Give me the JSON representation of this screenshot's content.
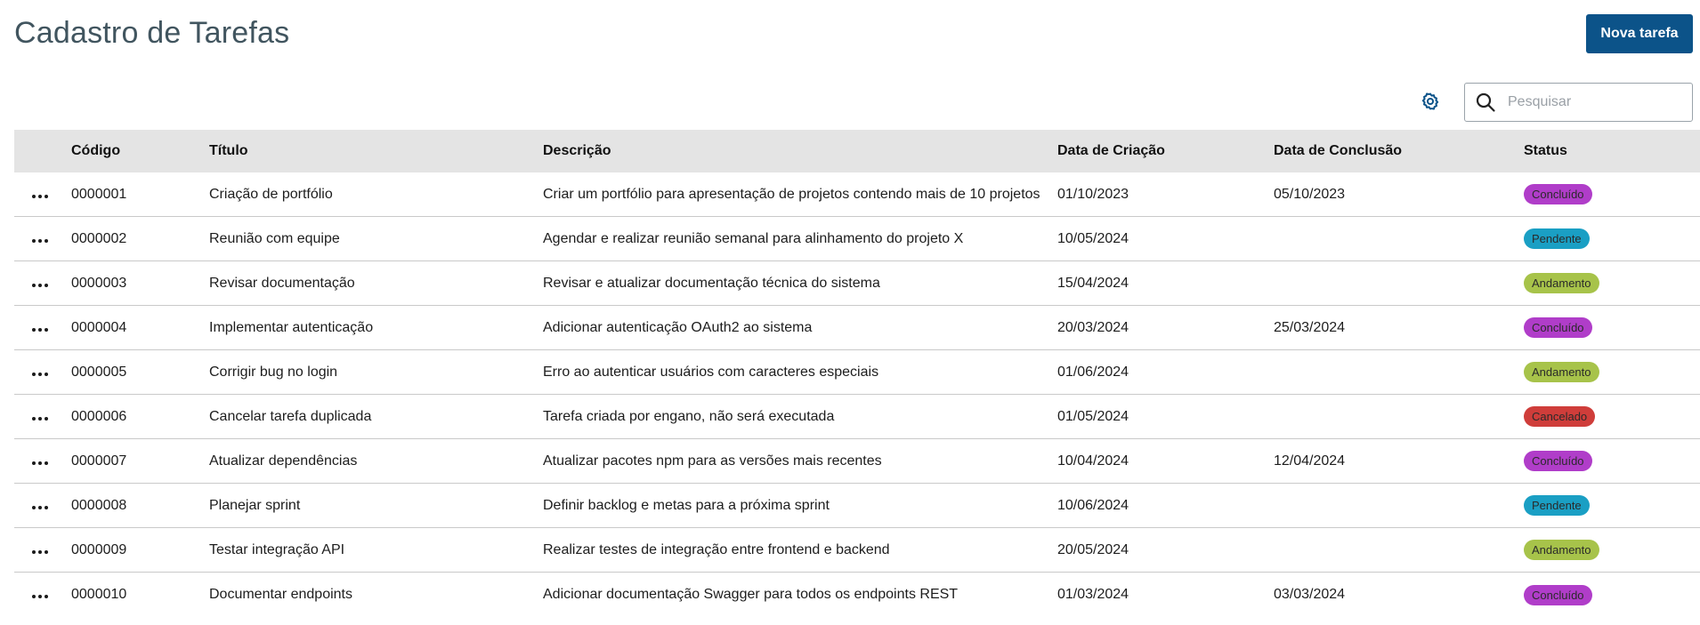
{
  "header": {
    "title": "Cadastro de Tarefas",
    "new_button_label": "Nova tarefa"
  },
  "toolbar": {
    "settings_icon": "gear-icon",
    "search_icon": "search-icon",
    "search_placeholder": "Pesquisar",
    "search_value": ""
  },
  "table": {
    "columns": [
      "",
      "Código",
      "Título",
      "Descrição",
      "Data de Criação",
      "Data de Conclusão",
      "Status"
    ],
    "rows": [
      {
        "code": "0000001",
        "title": "Criação de portfólio",
        "description": "Criar um portfólio para apresentação de projetos contendo mais de 10 projetos",
        "created": "01/10/2023",
        "completed": "05/10/2023",
        "status": "Concluído"
      },
      {
        "code": "0000002",
        "title": "Reunião com equipe",
        "description": "Agendar e realizar reunião semanal para alinhamento do projeto X",
        "created": "10/05/2024",
        "completed": "",
        "status": "Pendente"
      },
      {
        "code": "0000003",
        "title": "Revisar documentação",
        "description": "Revisar e atualizar documentação técnica do sistema",
        "created": "15/04/2024",
        "completed": "",
        "status": "Andamento"
      },
      {
        "code": "0000004",
        "title": "Implementar autenticação",
        "description": "Adicionar autenticação OAuth2 ao sistema",
        "created": "20/03/2024",
        "completed": "25/03/2024",
        "status": "Concluído"
      },
      {
        "code": "0000005",
        "title": "Corrigir bug no login",
        "description": "Erro ao autenticar usuários com caracteres especiais",
        "created": "01/06/2024",
        "completed": "",
        "status": "Andamento"
      },
      {
        "code": "0000006",
        "title": "Cancelar tarefa duplicada",
        "description": "Tarefa criada por engano, não será executada",
        "created": "01/05/2024",
        "completed": "",
        "status": "Cancelado"
      },
      {
        "code": "0000007",
        "title": "Atualizar dependências",
        "description": "Atualizar pacotes npm para as versões mais recentes",
        "created": "10/04/2024",
        "completed": "12/04/2024",
        "status": "Concluído"
      },
      {
        "code": "0000008",
        "title": "Planejar sprint",
        "description": "Definir backlog e metas para a próxima sprint",
        "created": "10/06/2024",
        "completed": "",
        "status": "Pendente"
      },
      {
        "code": "0000009",
        "title": "Testar integração API",
        "description": "Realizar testes de integração entre frontend e backend",
        "created": "20/05/2024",
        "completed": "",
        "status": "Andamento"
      },
      {
        "code": "0000010",
        "title": "Documentar endpoints",
        "description": "Adicionar documentação Swagger para todos os endpoints REST",
        "created": "01/03/2024",
        "completed": "03/03/2024",
        "status": "Concluído"
      }
    ]
  },
  "status_colors": {
    "Concluído": "#b03dc9",
    "Pendente": "#1a9fc4",
    "Andamento": "#a7c34a",
    "Cancelado": "#cf3d3a"
  },
  "colors": {
    "primary": "#0c5389",
    "title": "#41555f",
    "header_bg": "#e4e4e4"
  }
}
